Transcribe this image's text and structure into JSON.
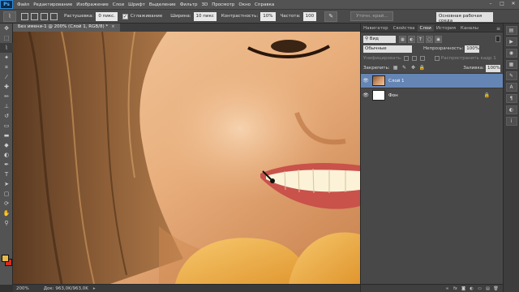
{
  "app": {
    "logo": "Ps"
  },
  "menu": [
    "Файл",
    "Редактирование",
    "Изображение",
    "Слои",
    "Шрифт",
    "Выделение",
    "Фильтр",
    "3D",
    "Просмотр",
    "Окно",
    "Справка"
  ],
  "window_controls": {
    "minimize": "–",
    "maximize": "□",
    "close": "✕"
  },
  "options": {
    "feather_label": "Растушевка:",
    "feather_value": "0 пикс.",
    "antialias_label": "Сглаживание",
    "antialias_checked": "✓",
    "width_label": "Ширина:",
    "width_value": "10 пикс",
    "contrast_label": "Контрастность:",
    "contrast_value": "10%",
    "frequency_label": "Частота:",
    "frequency_value": "100",
    "refine_edge": "Уточн. край...",
    "workspace": "Основная рабочая среда"
  },
  "document": {
    "tab_title": "Без имени-1 @ 200% (Слой 1, RGB/8) *",
    "close": "×"
  },
  "status": {
    "zoom": "200%",
    "doc_size": "Док: 963,0K/963,0K"
  },
  "panel_tabs": [
    "Навигатор",
    "Свойства",
    "Слои",
    "История",
    "Каналы"
  ],
  "panel_tab_active": "Слои",
  "layers_panel": {
    "kind_label": "Вид",
    "blend_mode": "Обычные",
    "opacity_label": "Непрозрачность:",
    "opacity_value": "100%",
    "unify_label": "Унифицировать:",
    "propagate_label": "Распространить кадр 1",
    "lock_label": "Закрепить:",
    "fill_label": "Заливка:",
    "fill_value": "100%",
    "layers": [
      {
        "name": "Слой 1",
        "selected": true
      },
      {
        "name": "Фон",
        "selected": false,
        "locked": true
      }
    ]
  },
  "colors": {
    "foreground": "#e5b94a",
    "background": "#d62e1e",
    "selected_layer": "#6585b5"
  },
  "icons": {
    "tool_icon": "magnetic-lasso-icon",
    "eye": "eye-icon",
    "lock": "lock-icon"
  }
}
